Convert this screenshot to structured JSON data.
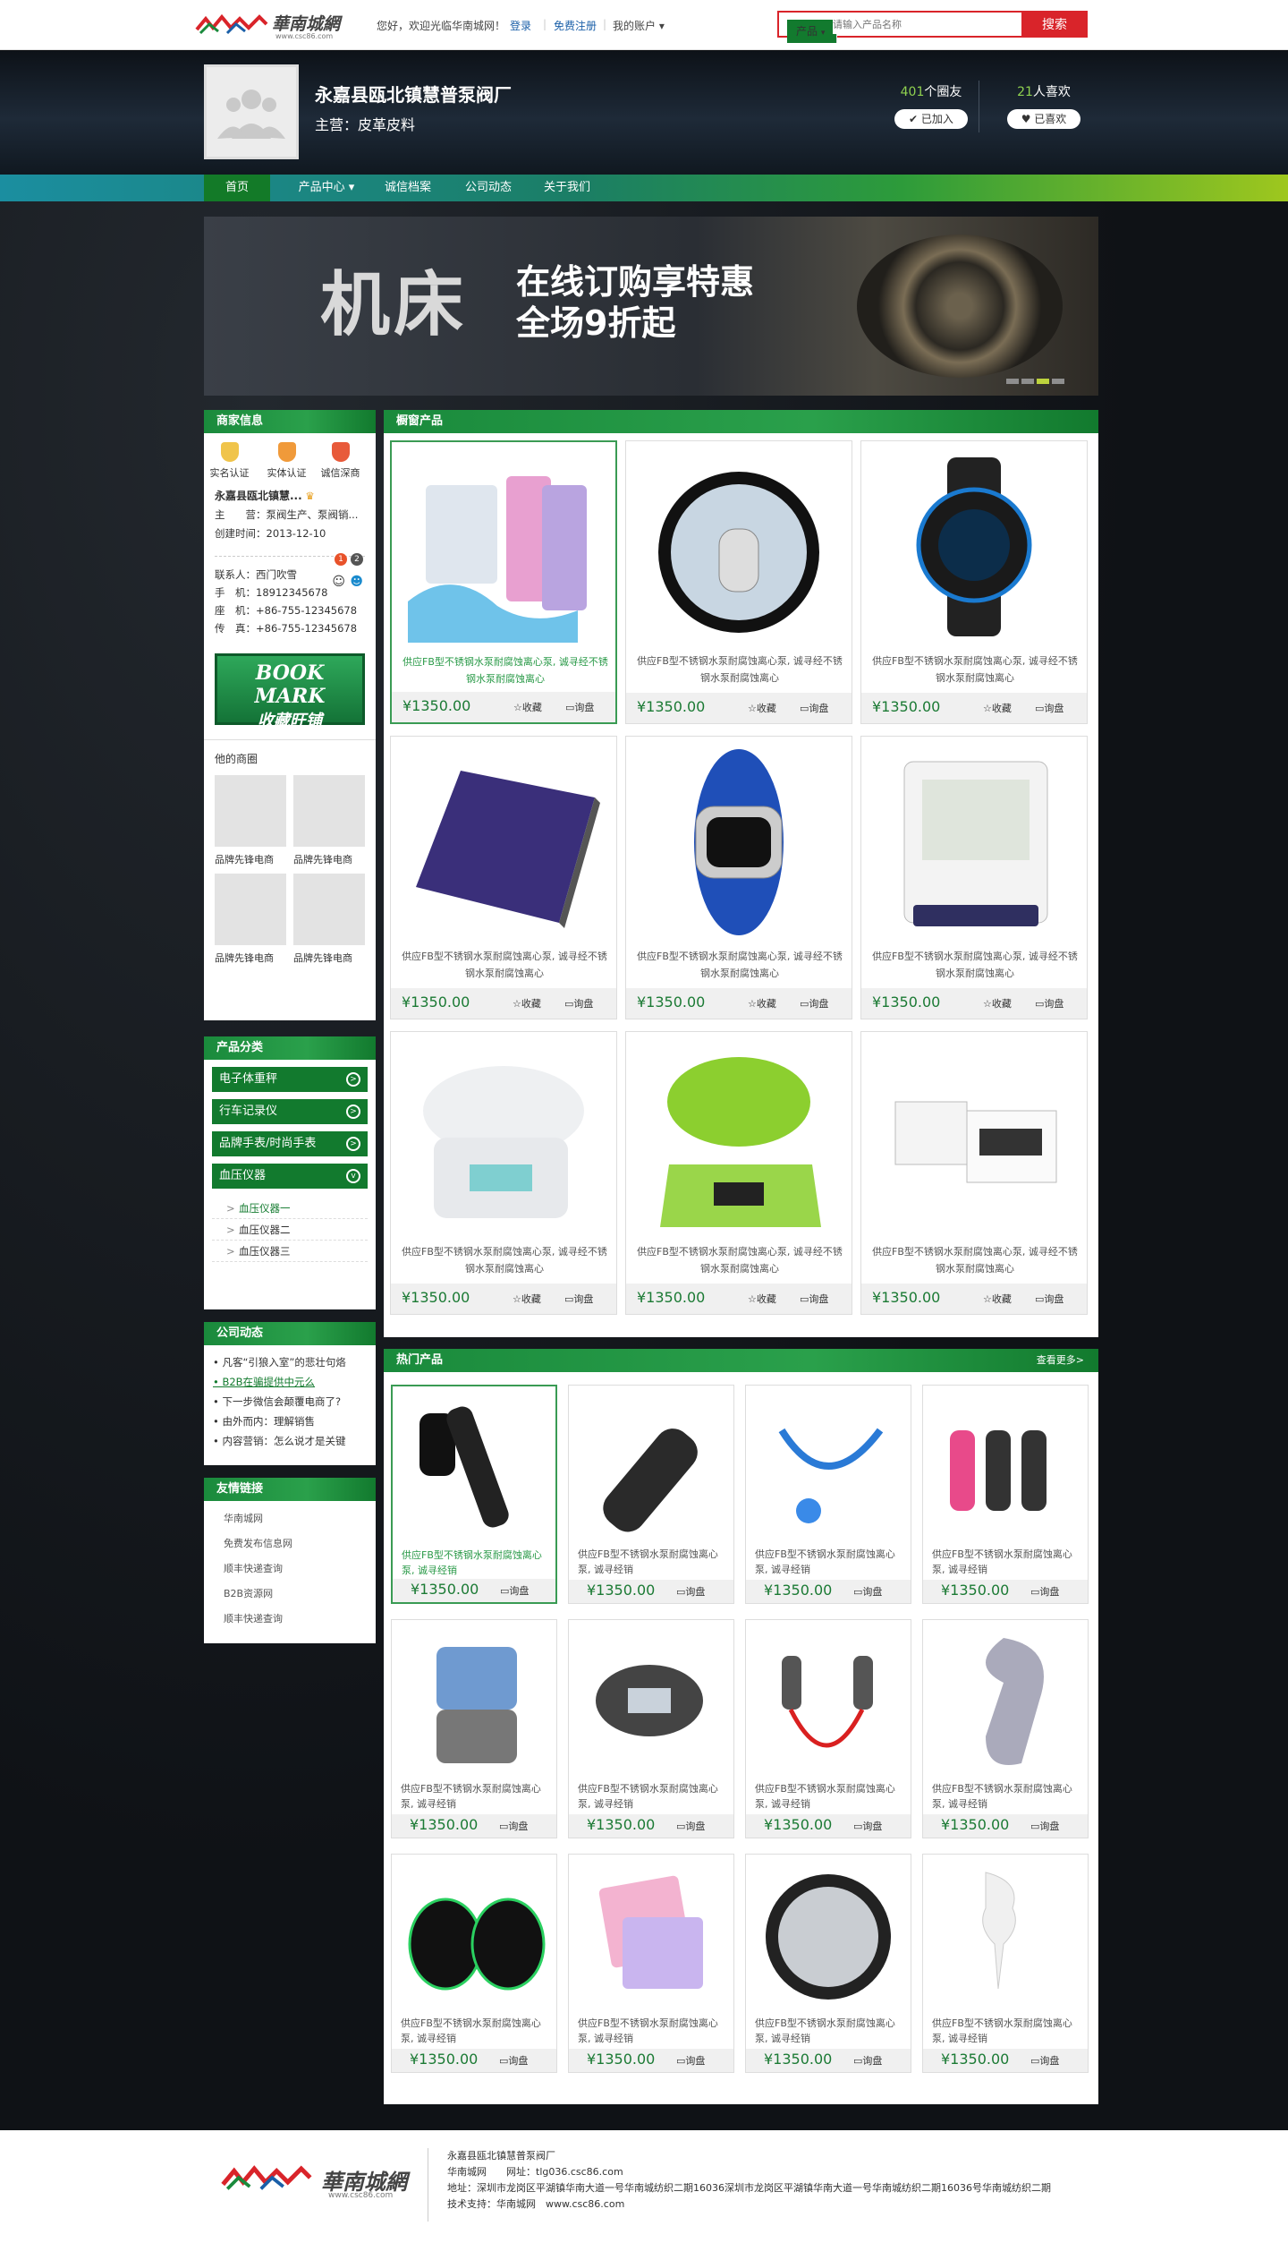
{
  "topbar": {
    "site_text": "華南城網",
    "site_url": "www.csc86.com",
    "welcome": "您好，欢迎光临华南城网！",
    "login": "登录",
    "register": "免费注册",
    "account": "我的账户",
    "search_cat": "产品",
    "search_placeholder": "请输入产品名称",
    "search_btn": "搜索"
  },
  "header": {
    "company": "永嘉县瓯北镇慧普泵阀厂",
    "main_business": "主营：皮革皮料",
    "friends_count": "401",
    "friends_label": "个圈友",
    "friends_btn": "已加入",
    "likes_count": "21",
    "likes_label": "人喜欢",
    "likes_btn": "已喜欢"
  },
  "nav": [
    "首页",
    "产品中心 ▾",
    "诚信档案",
    "公司动态",
    "关于我们"
  ],
  "banner": {
    "big": "机床",
    "line1": "在线订购享特惠",
    "line2": "全场9折起"
  },
  "merchant": {
    "title": "商家信息",
    "certs": [
      "实名认证",
      "实体认证",
      "诚信深商"
    ],
    "name": "永嘉县瓯北镇慧...",
    "biz": "主　　营：泵阀生产、泵阀销...",
    "created": "创建时间：2013-12-10",
    "contact": [
      "联系人：西门吹雪",
      "手　机：18912345678",
      "座　机：+86-755-12345678",
      "传　真：+86-755-12345678"
    ],
    "bookmark_en": "BOOK MARK",
    "bookmark_cn": "收藏旺铺",
    "circle_title": "他的商圈",
    "circles": [
      "品牌先锋电商",
      "品牌先锋电商",
      "品牌先锋电商",
      "品牌先锋电商"
    ],
    "badge1": "1",
    "badge2": "2"
  },
  "categories": {
    "title": "产品分类",
    "items": [
      "电子体重秤",
      "行车记录仪",
      "品牌手表/时尚手表",
      "血压仪器"
    ],
    "subs": [
      "血压仪器一",
      "血压仪器二",
      "血压仪器三"
    ]
  },
  "news": {
    "title": "公司动态",
    "items": [
      "凡客“引狼入室”的悲壮句烙",
      "B2B在骗提供中元么",
      "下一步微信会颠覆电商了?",
      "由外而内：理解销售",
      "内容营销：怎么说才是关键"
    ]
  },
  "links": {
    "title": "友情链接",
    "items": [
      "华南城网",
      "免费发布信息网",
      "顺丰快递查询",
      "B2B资源网",
      "顺丰快递查询"
    ]
  },
  "window": {
    "title": "橱窗产品",
    "name": "供应FB型不锈钢水泵耐腐蚀离心泵, 诚寻经不锈钢水泵耐腐蚀离心",
    "price": "¥1350.00",
    "fav": "收藏",
    "ask": "询盘"
  },
  "hot": {
    "title": "热门产品",
    "more": "查看更多>",
    "name": "供应FB型不锈钢水泵耐腐蚀离心泵, 诚寻经销",
    "price": "¥1350.00",
    "ask": "询盘"
  },
  "footer": {
    "company": "永嘉县瓯北镇慧普泵阀厂",
    "site": "华南城网",
    "web": "网址：tlg036.csc86.com",
    "address": "地址：深圳市龙岗区平湖镇华南大道一号华南城纺织二期16036深圳市龙岗区平湖镇华南大道一号华南城纺织二期16036号华南城纺织二期",
    "support": "技术支持：华南城网",
    "support_url": "www.csc86.com"
  },
  "colors": {
    "brand_green": "#127a2e",
    "search_red": "#d9242a",
    "accent_lime": "#8fd14f"
  }
}
